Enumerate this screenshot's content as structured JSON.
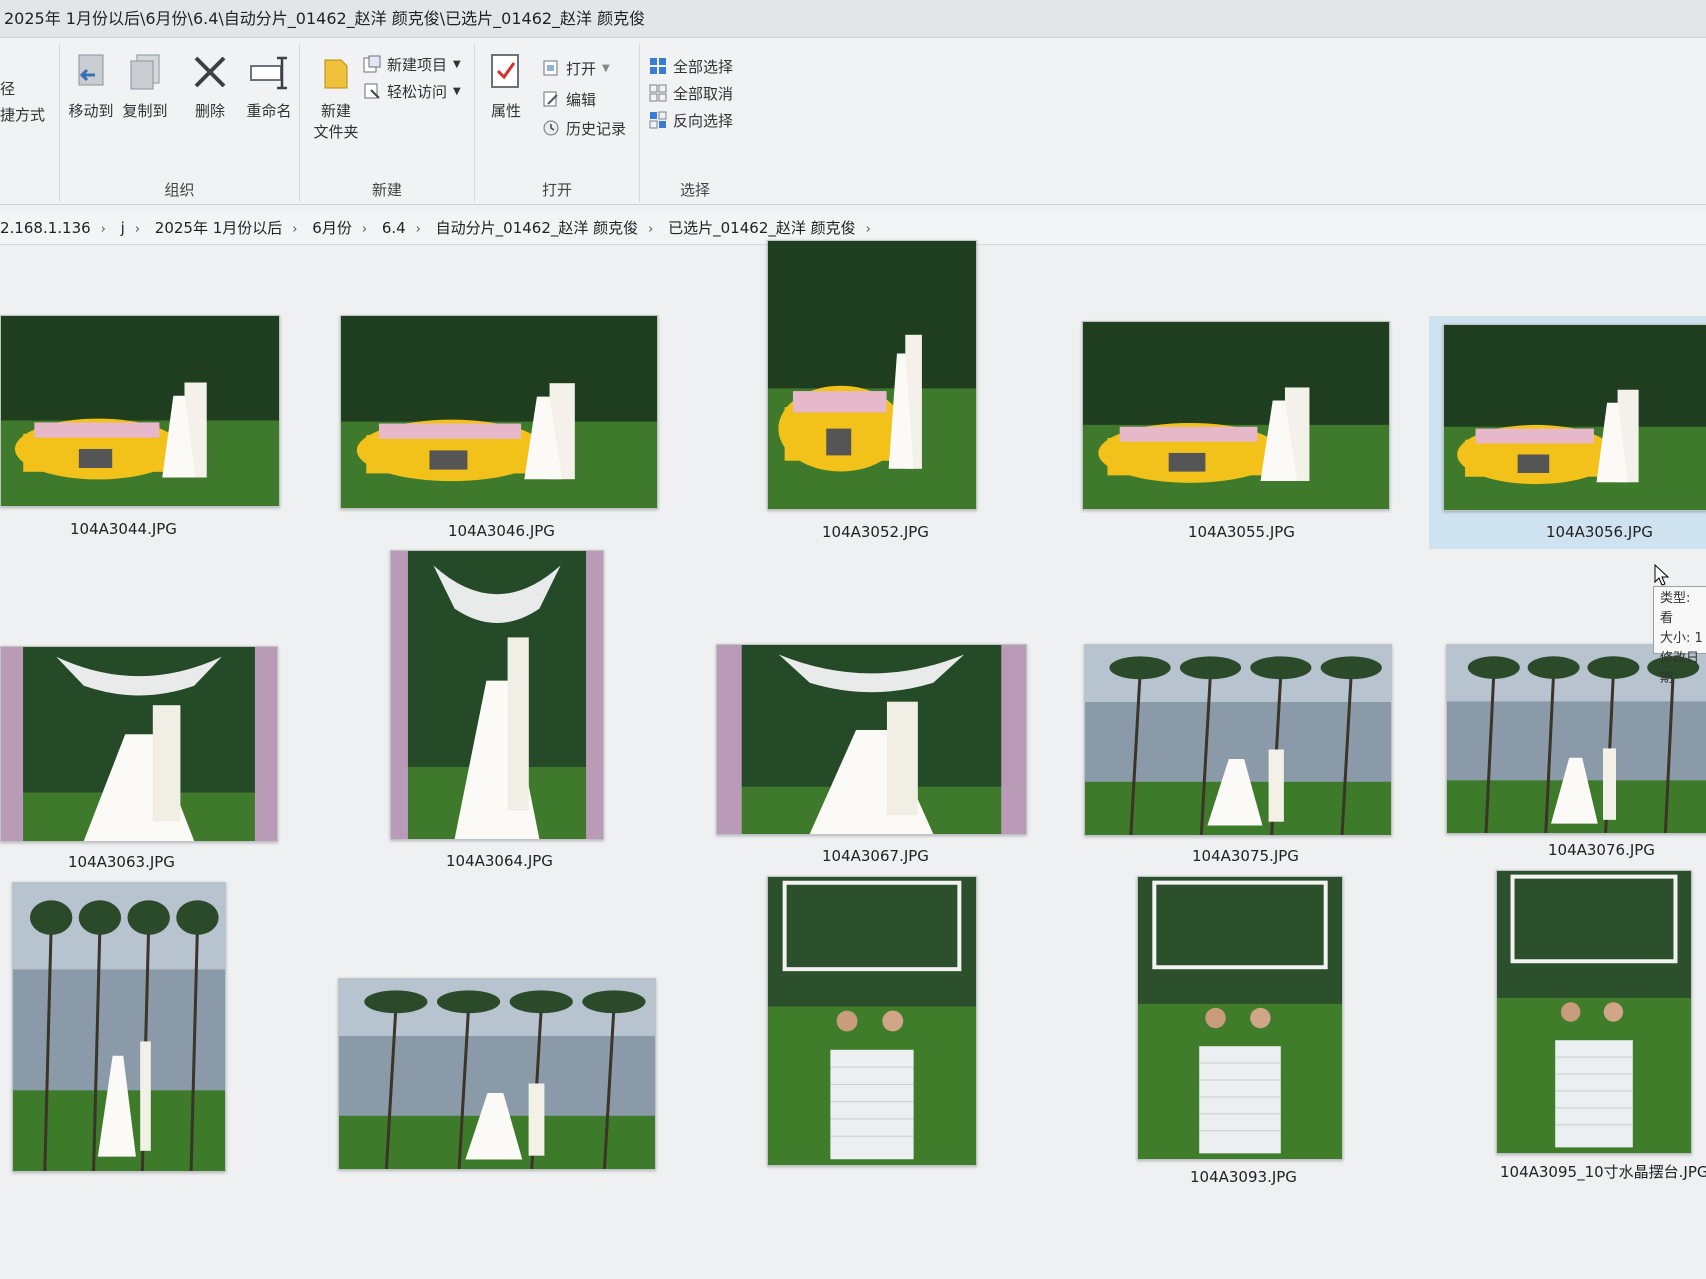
{
  "window": {
    "title_path": "2025年 1月份以后\\6月份\\6.4\\自动分片_01462_赵洋 颜克俊\\已选片_01462_赵洋 颜克俊"
  },
  "ribbon": {
    "clipboard_partial": {
      "line1": "径",
      "line2": "捷方式"
    },
    "organize": {
      "label": "组织",
      "move_to": "移动到",
      "copy_to": "复制到",
      "delete": "删除",
      "rename": "重命名"
    },
    "new": {
      "label": "新建",
      "new_folder_line1": "新建",
      "new_folder_line2": "文件夹",
      "new_item": "新建项目",
      "easy_access": "轻松访问"
    },
    "open": {
      "label": "打开",
      "properties": "属性",
      "open": "打开",
      "edit": "编辑",
      "history": "历史记录"
    },
    "select": {
      "label": "选择",
      "select_all": "全部选择",
      "select_none": "全部取消",
      "invert": "反向选择"
    }
  },
  "breadcrumb": [
    "2.168.1.136",
    "j",
    "2025年 1月份以后",
    "6月份",
    "6.4",
    "自动分片_01462_赵洋 颜克俊",
    "已选片_01462_赵洋 颜克俊"
  ],
  "files": [
    {
      "name": "104A3044.JPG",
      "scene": "car"
    },
    {
      "name": "104A3046.JPG",
      "scene": "car"
    },
    {
      "name": "104A3052.JPG",
      "scene": "car"
    },
    {
      "name": "104A3055.JPG",
      "scene": "car"
    },
    {
      "name": "104A3056.JPG",
      "scene": "car",
      "selected": true
    },
    {
      "name": "104A3063.JPG",
      "scene": "arch"
    },
    {
      "name": "104A3064.JPG",
      "scene": "arch"
    },
    {
      "name": "104A3067.JPG",
      "scene": "arch"
    },
    {
      "name": "104A3075.JPG",
      "scene": "lake"
    },
    {
      "name": "104A3076.JPG",
      "scene": "lake"
    },
    {
      "name": "",
      "scene": "lake"
    },
    {
      "name": "",
      "scene": "lake"
    },
    {
      "name": "",
      "scene": "glass"
    },
    {
      "name": "104A3093.JPG",
      "scene": "glass"
    },
    {
      "name": "104A3095_10寸水晶摆台.JPG",
      "scene": "glass"
    }
  ],
  "tooltip": {
    "type": "类型: 看",
    "size": "大小: 1",
    "modified": "修改日期"
  },
  "colors": {
    "accent": "#0078d7",
    "grass": "#3f7a2c",
    "trees": "#1f3d1f",
    "car_yellow": "#f2c21a",
    "water": "#8a9aa8",
    "sky": "#b7c3cf"
  }
}
